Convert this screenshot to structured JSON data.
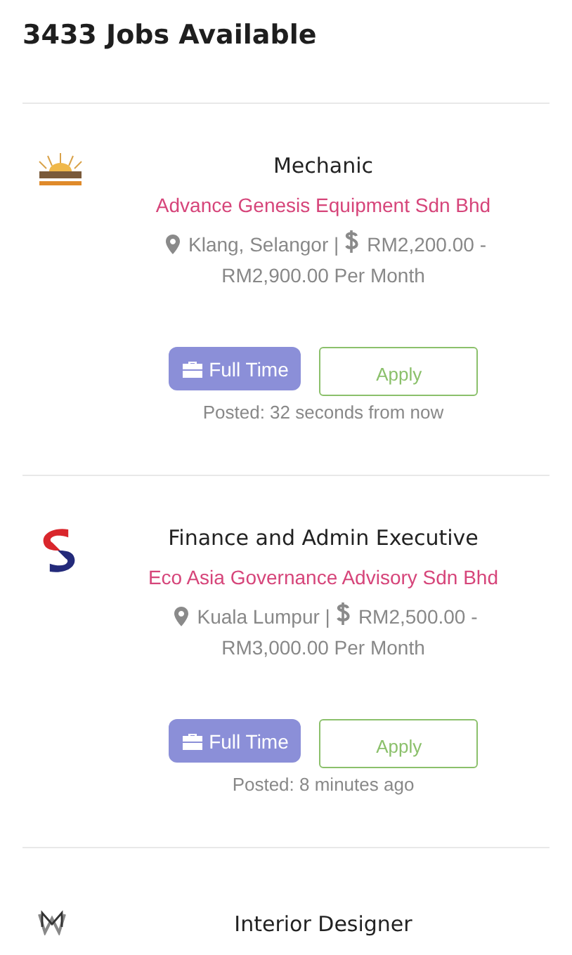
{
  "heading": "3433 Jobs Available",
  "jobs": [
    {
      "title": "Mechanic",
      "company": "Advance Genesis Equipment Sdn Bhd",
      "location": "Klang, Selangor |",
      "salary_from": "RM2,200.00 -",
      "salary_to": "RM2,900.00 Per Month",
      "type": "Full Time",
      "apply": "Apply",
      "posted": "Posted: 32 seconds from now"
    },
    {
      "title": "Finance and Admin Executive",
      "company": "Eco Asia Governance Advisory Sdn Bhd",
      "location": "Kuala Lumpur |",
      "salary_from": "RM2,500.00 -",
      "salary_to": "RM3,000.00 Per Month",
      "type": "Full Time",
      "apply": "Apply",
      "posted": "Posted: 8 minutes ago"
    },
    {
      "title": "Interior Designer"
    }
  ]
}
